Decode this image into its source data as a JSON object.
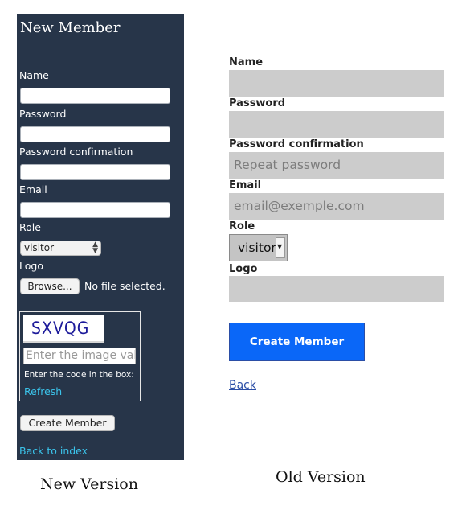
{
  "new_version": {
    "title": "New Member",
    "labels": {
      "name": "Name",
      "password": "Password",
      "password_confirmation": "Password confirmation",
      "email": "Email",
      "role": "Role",
      "logo": "Logo"
    },
    "fields": {
      "name": "",
      "password": "",
      "password_confirmation": "",
      "email": ""
    },
    "role_value": "visitor",
    "browse_label": "Browse...",
    "no_file_text": "No file selected.",
    "captcha": {
      "code": "SXVQG",
      "input_placeholder": "Enter the image value",
      "hint": "Enter the code in the box:",
      "refresh_label": "Refresh"
    },
    "create_label": "Create Member",
    "back_label": "Back to index",
    "colors": {
      "background": "#273549",
      "link": "#3bc3ea"
    }
  },
  "old_version": {
    "labels": {
      "name": "Name",
      "password": "Password",
      "password_confirmation": "Password confirmation",
      "email": "Email",
      "role": "Role",
      "logo": "Logo"
    },
    "placeholders": {
      "name": "",
      "password": "",
      "password_confirmation": "Repeat password",
      "email": "email@exemple.com"
    },
    "role_value": "visitor",
    "create_label": "Create Member",
    "back_label": "Back",
    "colors": {
      "button": "#0a67f8",
      "field": "#cccccc",
      "link": "#2b4ea6"
    }
  },
  "captions": {
    "new": "New Version",
    "old": "Old Version"
  }
}
